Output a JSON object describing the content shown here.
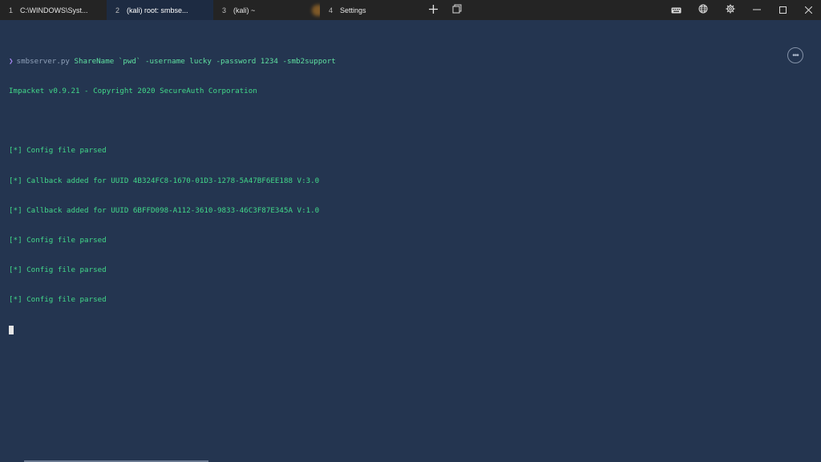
{
  "tabs": [
    {
      "num": "1",
      "title": "C:\\WINDOWS\\Syst..."
    },
    {
      "num": "2",
      "title": "(kali) root: smbse..."
    },
    {
      "num": "3",
      "title": "(kali) ~"
    },
    {
      "num": "4",
      "title": "Settings"
    }
  ],
  "toolbar": {
    "new_tab_icon": "plus-icon",
    "duplicate_icon": "duplicate-window-icon",
    "keyboard_icon": "keyboard-icon",
    "globe_icon": "globe-icon",
    "settings_icon": "gear-icon",
    "minimize": "—",
    "maximize": "☐",
    "close": "✕"
  },
  "terminal": {
    "prompt_symbol": "❯",
    "command_name": "smbserver.py",
    "command_args": " ShareName `pwd` -username lucky -password 1234 -smb2support",
    "output": [
      "Impacket v0.9.21 - Copyright 2020 SecureAuth Corporation",
      "",
      "[*] Config file parsed",
      "[*] Callback added for UUID 4B324FC8-1670-01D3-1278-5A47BF6EE188 V:3.0",
      "[*] Callback added for UUID 6BFFD098-A112-3610-9833-46C3F87E345A V:1.0",
      "[*] Config file parsed",
      "[*] Config file parsed",
      "[*] Config file parsed"
    ],
    "more_button": "•••"
  },
  "colors": {
    "background": "#243550",
    "tabbar": "#242424",
    "active_tab": "#1d2b42",
    "text_green": "#42d989",
    "prompt": "#a586f2"
  }
}
